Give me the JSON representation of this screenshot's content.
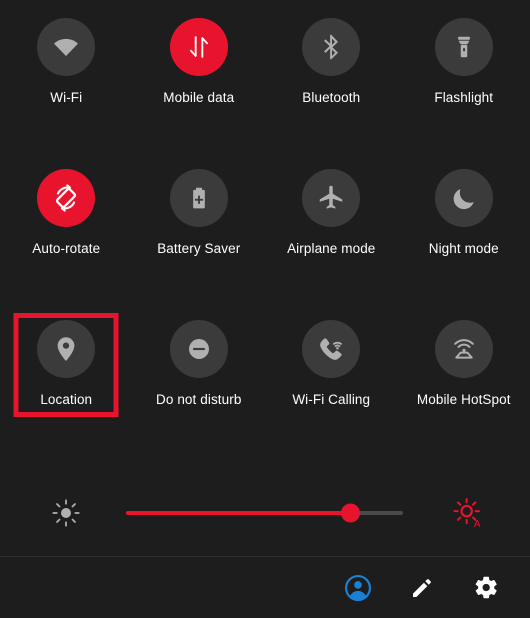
{
  "panel": {
    "background_color": "#1d1d1d",
    "accent_color": "#e8142d",
    "tile_off_color": "#3b3b3b",
    "icon_color": "#b0b0b0",
    "label_color": "#ffffff"
  },
  "tiles": [
    {
      "label": "Wi-Fi",
      "icon": "wifi-icon",
      "state": "off",
      "highlighted": false
    },
    {
      "label": "Mobile data",
      "icon": "mobile-data-icon",
      "state": "on",
      "highlighted": false
    },
    {
      "label": "Bluetooth",
      "icon": "bluetooth-icon",
      "state": "off",
      "highlighted": false
    },
    {
      "label": "Flashlight",
      "icon": "flashlight-icon",
      "state": "off",
      "highlighted": false
    },
    {
      "label": "Auto-rotate",
      "icon": "auto-rotate-icon",
      "state": "on",
      "highlighted": false
    },
    {
      "label": "Battery Saver",
      "icon": "battery-saver-icon",
      "state": "off",
      "highlighted": false
    },
    {
      "label": "Airplane mode",
      "icon": "airplane-icon",
      "state": "off",
      "highlighted": false
    },
    {
      "label": "Night mode",
      "icon": "moon-icon",
      "state": "off",
      "highlighted": false
    },
    {
      "label": "Location",
      "icon": "location-pin-icon",
      "state": "off",
      "highlighted": true
    },
    {
      "label": "Do not disturb",
      "icon": "do-not-disturb-icon",
      "state": "off",
      "highlighted": false
    },
    {
      "label": "Wi-Fi Calling",
      "icon": "wifi-calling-icon",
      "state": "off",
      "highlighted": false
    },
    {
      "label": "Mobile HotSpot",
      "icon": "hotspot-icon",
      "state": "off",
      "highlighted": false
    }
  ],
  "brightness": {
    "low_icon": "brightness-low-icon",
    "auto_icon": "brightness-auto-icon",
    "fill_percent": 81
  },
  "bottom_bar": {
    "items": [
      {
        "icon": "user-account-icon",
        "color": "#1a82d6"
      },
      {
        "icon": "edit-pencil-icon",
        "color": "#ffffff"
      },
      {
        "icon": "settings-gear-icon",
        "color": "#ffffff"
      }
    ]
  }
}
